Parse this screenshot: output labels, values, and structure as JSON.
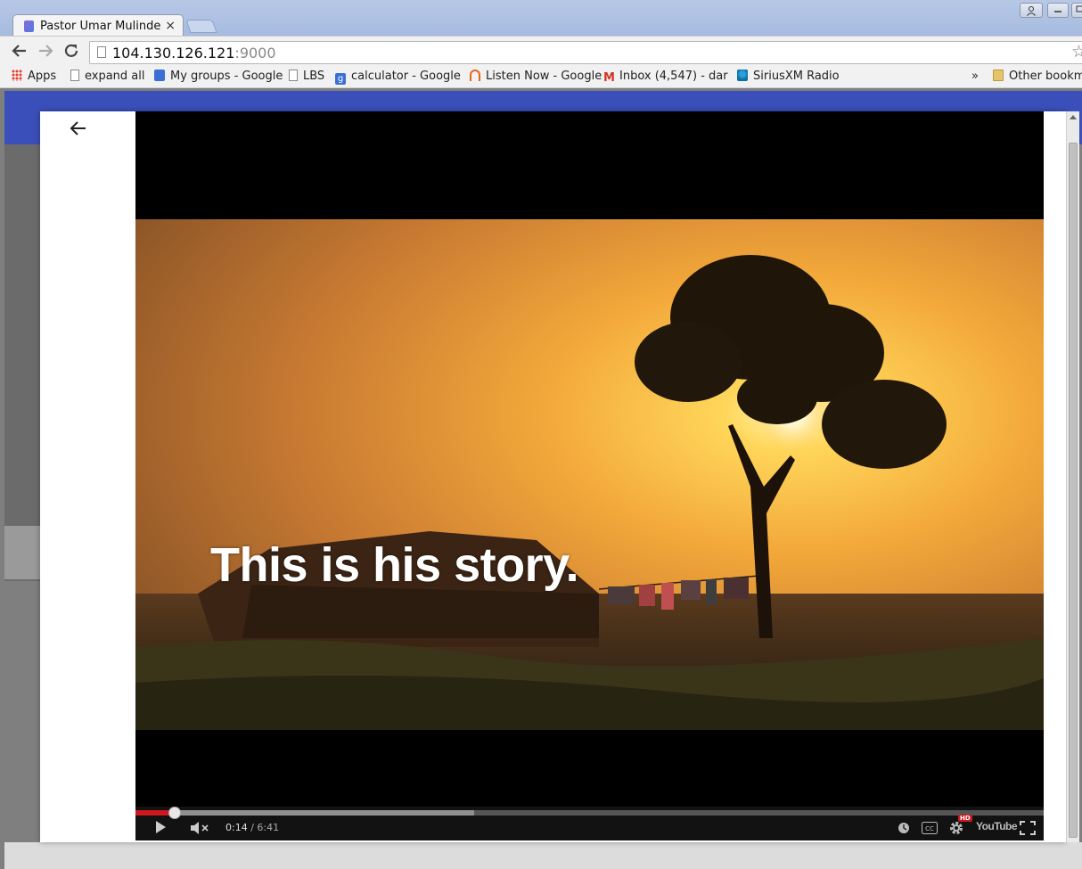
{
  "browser": {
    "tab": {
      "title": "Pastor Umar Mulinde",
      "close": "×"
    },
    "address": {
      "host": "104.130.126.121",
      "port": ":9000"
    },
    "bookmarks": [
      {
        "label": "Apps",
        "icon": "apps-grid-icon"
      },
      {
        "label": "expand all",
        "icon": "page-icon"
      },
      {
        "label": "My groups - Google",
        "icon": "groups-icon"
      },
      {
        "label": "LBS",
        "icon": "page-icon"
      },
      {
        "label": "calculator - Google",
        "icon": "google-icon"
      },
      {
        "label": "Listen Now - Google",
        "icon": "headphones-icon"
      },
      {
        "label": "Inbox (4,547) - dar",
        "icon": "gmail-icon"
      },
      {
        "label": "SiriusXM Radio",
        "icon": "siriusxm-icon"
      }
    ],
    "bookmarks_overflow": "»",
    "other_bookmarks": "Other bookm"
  },
  "modal": {
    "back_icon": "arrow-left-icon"
  },
  "video": {
    "caption": "This is his story.",
    "time_current": "0:14",
    "time_separator": " / ",
    "time_total": "6:41",
    "progress_played": 0.0429,
    "progress_buffered": 0.373,
    "youtube_logo": "YouTube",
    "hd_badge": "HD"
  },
  "colors": {
    "page_banner": "#3a4fba",
    "progress_red": "#cc181e"
  }
}
